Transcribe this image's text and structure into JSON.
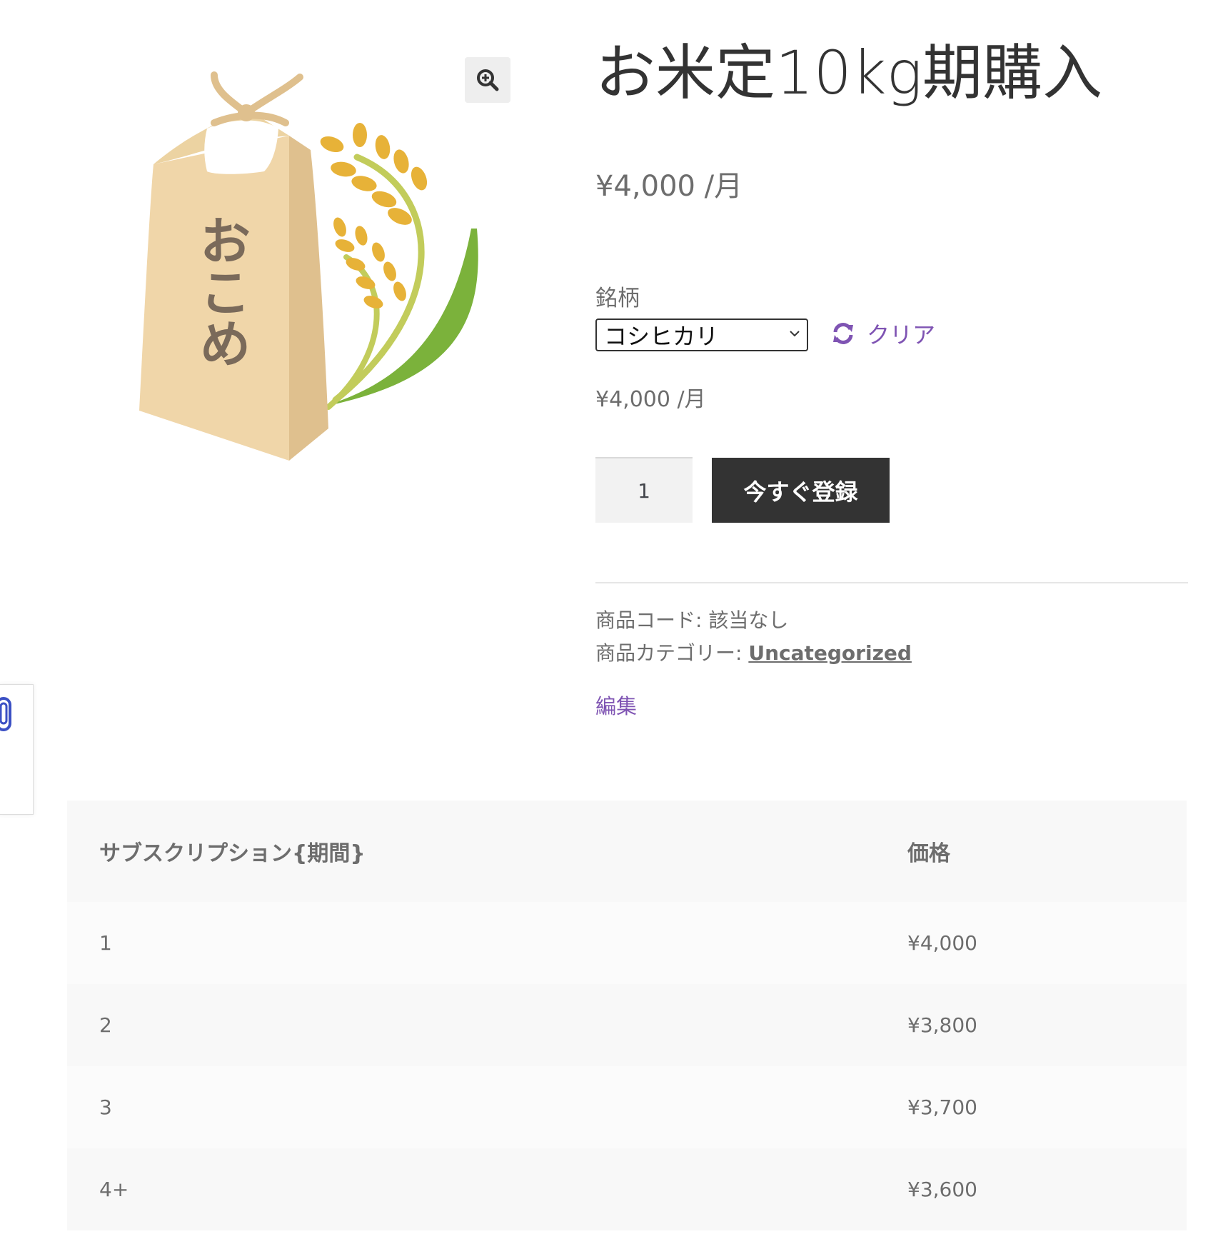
{
  "product": {
    "title": "お米定10kg期購入",
    "price": "¥4,000 /月",
    "variation_label": "銘柄",
    "variation_selected": "コシヒカリ",
    "reset_label": "クリア",
    "variation_price": "¥4,000 /月",
    "quantity": "1",
    "add_button_label": "今すぐ登録",
    "sku_label": "商品コード: ",
    "sku_value": "該当なし",
    "category_label": "商品カテゴリー: ",
    "category_value": "Uncategorized",
    "edit_label": "編集"
  },
  "image": {
    "bag_text": "おこめ"
  },
  "pricing_table": {
    "headers": [
      "サブスクリプション{期間}",
      "価格"
    ],
    "rows": [
      {
        "period": "1",
        "price": "¥4,000"
      },
      {
        "period": "2",
        "price": "¥3,800"
      },
      {
        "period": "3",
        "price": "¥3,700"
      },
      {
        "period": "4+",
        "price": "¥3,600"
      }
    ]
  },
  "colors": {
    "accent": "#7f54b3",
    "button_bg": "#333333",
    "table_header_bg": "#f8f8f8"
  }
}
